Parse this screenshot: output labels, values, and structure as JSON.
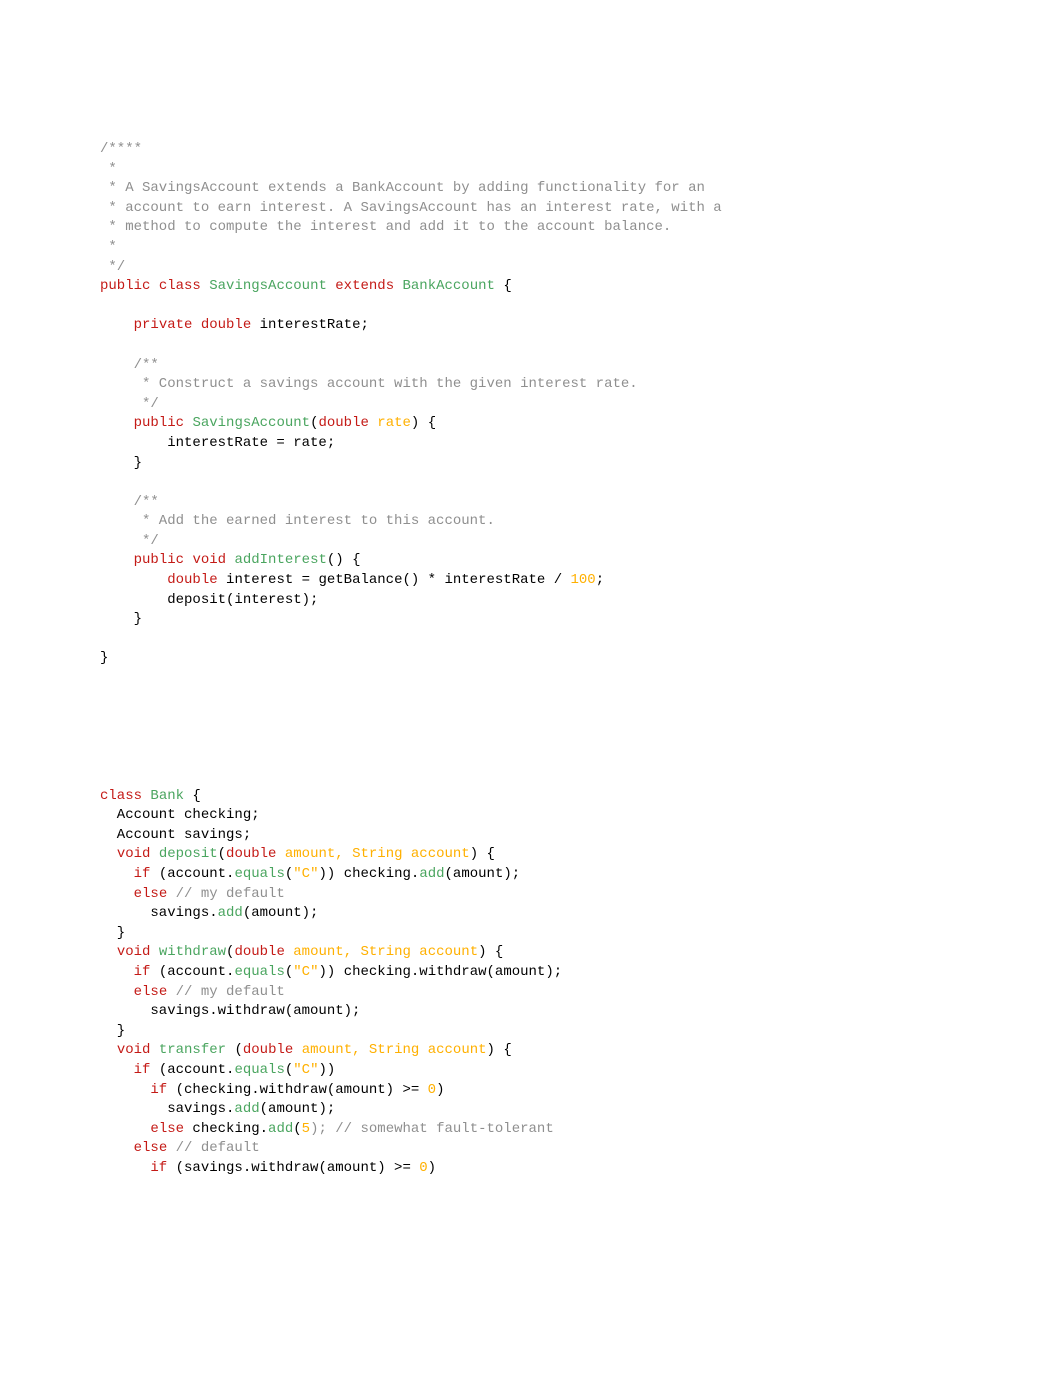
{
  "code": {
    "block1": {
      "c1": "/****",
      "c2": " *",
      "c3": " * A SavingsAccount extends a BankAccount by adding functionality for an",
      "c4": " * account to earn interest. A SavingsAccount has an interest rate, with a",
      "c5": " * method to compute the interest and add it to the account balance.",
      "c6": " *",
      "c7": " */",
      "kw_public": "public",
      "kw_class": "class",
      "cn_savings": "SavingsAccount",
      "kw_extends": "extends",
      "cn_bank": "BankAccount",
      "kw_private": "private",
      "kw_double": "double",
      "var_interestRate": "interestRate;",
      "c8": "    /**",
      "c9": "     * Construct a savings account with the given interest rate.",
      "c10": "     */",
      "m_constructor": "SavingsAccount",
      "p_rate": "rate",
      "l_body1": "        interestRate = rate;",
      "c11": "    /**",
      "c12": "     * Add the earned interest to this account.",
      "c13": "     */",
      "kw_void": "void",
      "m_addInterest": "addInterest",
      "l_body2a": "        ",
      "l_body2b": " interest = getBalance() * interestRate / ",
      "n_100": "100",
      "l_body3": "        deposit(interest);"
    },
    "block2": {
      "kw_class": "class",
      "cn_bank": "Bank",
      "l1": "  Account checking;",
      "l2": "  Account savings;",
      "kw_void": "void",
      "m_deposit": "deposit",
      "kw_double": "double",
      "p_amount_str_acc": "amount, String account",
      "kw_if": "if",
      "l_acc_equals": " (account.",
      "m_equals": "equals",
      "s_c": "\"C\"",
      "l_chk_add": ")) checking.",
      "m_add": "add",
      "l_amt_close": "(amount);",
      "kw_else": "else",
      "c_default": " // my default",
      "l_sav_add": "      savings.",
      "m_withdraw": "withdraw",
      "l_chk_withdraw": ")) checking.withdraw(amount);",
      "l_sav_withdraw": "      savings.withdraw(amount);",
      "m_transfer": "transfer",
      "l_if_chk_w": "      if (checking.withdraw(amount) >= ",
      "n_0": "0",
      "l_sav_add2": "        savings.",
      "l_else_chk_add5a": " checking.",
      "n_5": "5",
      "c_fault": "); // somewhat fault-tolerant",
      "c_default2": " // default",
      "l_if_sav_w": "      if (savings.withdraw(amount) >= "
    }
  }
}
